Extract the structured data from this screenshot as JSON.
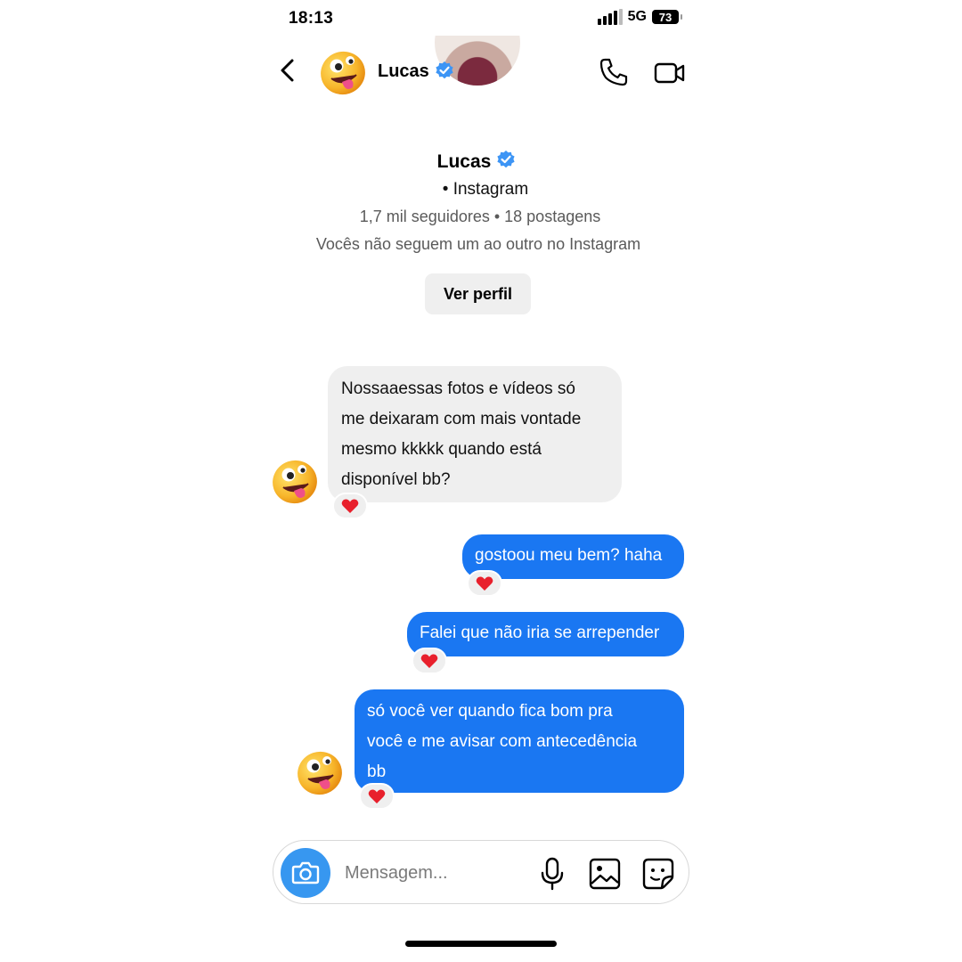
{
  "status_bar": {
    "time": "18:13",
    "network": "5G",
    "battery": "73"
  },
  "header": {
    "contact_name": "Lucas",
    "verified": true,
    "avatar_icon": "zany-face-emoji",
    "actions": [
      "back-icon",
      "phone-call-icon",
      "video-call-icon"
    ]
  },
  "profile": {
    "name": "Lucas",
    "subtitle": "• Instagram",
    "stats": "1,7 mil seguidores • 18 postagens",
    "follow_status": "Vocês não seguem um ao outro no Instagram",
    "view_profile_label": "Ver perfil"
  },
  "messages": [
    {
      "direction": "incoming",
      "lines": [
        "Nossaaessas fotos e vídeos só",
        "me deixaram com mais vontade",
        "mesmo kkkkk quando está",
        "disponível bb?"
      ],
      "reaction": "red-heart"
    },
    {
      "direction": "outgoing",
      "lines": [
        "gostoou meu bem? haha"
      ],
      "reaction": "red-heart"
    },
    {
      "direction": "outgoing",
      "lines": [
        "Falei que não iria se arrepender"
      ],
      "reaction": "red-heart"
    },
    {
      "direction": "outgoing",
      "lines": [
        "só você ver quando fica bom pra",
        "você e me avisar com antecedência",
        "bb"
      ],
      "reaction": "red-heart"
    }
  ],
  "composer": {
    "placeholder": "Mensagem...",
    "icons": [
      "camera-icon",
      "microphone-icon",
      "gallery-icon",
      "sticker-icon"
    ]
  },
  "colors": {
    "outgoing_bubble": "#1a77f2",
    "incoming_bubble": "#efefef",
    "verified_badge": "#3d95f5",
    "camera_button": "#3797f0",
    "heart": "#e8202c"
  }
}
